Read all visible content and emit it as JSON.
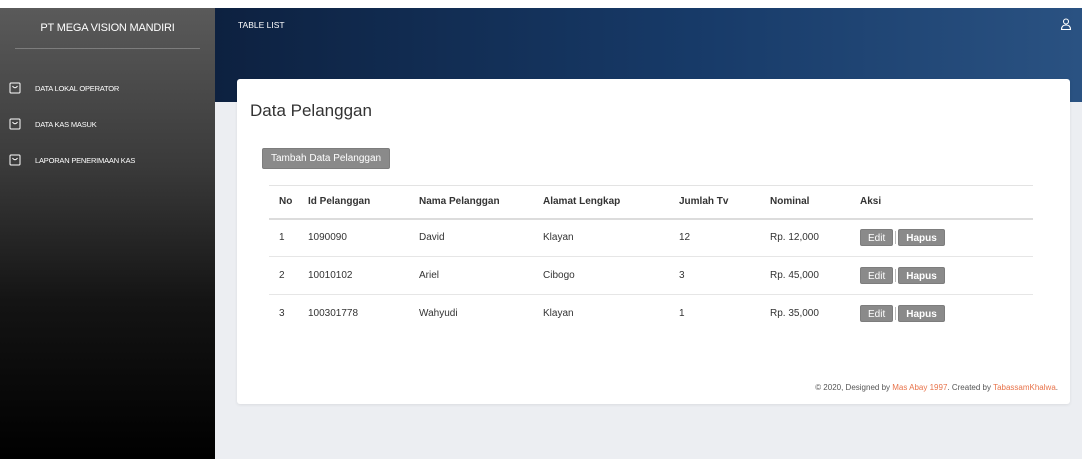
{
  "sidebar": {
    "brand": "PT MEGA VISION MANDIRI",
    "items": [
      {
        "label": "DATA LOKAL OPERATOR",
        "icon": "shopping-bag-icon"
      },
      {
        "label": "DATA KAS MASUK",
        "icon": "shopping-bag-icon"
      },
      {
        "label": "LAPORAN PENERIMAAN KAS",
        "icon": "shopping-bag-icon"
      }
    ]
  },
  "topbar": {
    "title": "TABLE LIST",
    "user_icon": "user-icon"
  },
  "card": {
    "title": "Data Pelanggan",
    "add_button": "Tambah Data Pelanggan"
  },
  "table": {
    "headers": {
      "no": "No",
      "id": "Id Pelanggan",
      "nama": "Nama Pelanggan",
      "alamat": "Alamat Lengkap",
      "jumlah": "Jumlah Tv",
      "nominal": "Nominal",
      "aksi": "Aksi"
    },
    "rows": [
      {
        "no": "1",
        "id": "1090090",
        "nama": "David",
        "alamat": "Klayan",
        "jumlah": "12",
        "nominal": "Rp. 12,000"
      },
      {
        "no": "2",
        "id": "10010102",
        "nama": "Ariel",
        "alamat": "Cibogo",
        "jumlah": "3",
        "nominal": "Rp. 45,000"
      },
      {
        "no": "3",
        "id": "100301778",
        "nama": "Wahyudi",
        "alamat": "Klayan",
        "jumlah": "1",
        "nominal": "Rp. 35,000"
      }
    ],
    "edit_label": "Edit",
    "hapus_label": "Hapus"
  },
  "footer": {
    "prefix": "© 2020, Designed by ",
    "designer": "Mas Abay 1997",
    "middle": ". Created by ",
    "creator": "TabassamKhalwa",
    "suffix": "."
  },
  "colors": {
    "sidebar_top": "#5a5a5a",
    "sidebar_bottom": "#000000",
    "topbar": "#173a68",
    "button": "#8a8a8a",
    "footer_link": "#e8734a"
  }
}
